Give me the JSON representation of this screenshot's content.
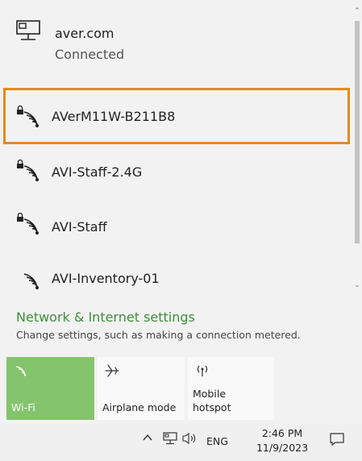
{
  "networks": {
    "connected": {
      "name": "aver.com",
      "status": "Connected"
    },
    "items": [
      {
        "name": "AVerM11W-B211B8",
        "secured": true
      },
      {
        "name": "AVI-Staff-2.4G",
        "secured": true
      },
      {
        "name": "AVI-Staff",
        "secured": true
      },
      {
        "name": "AVI-Inventory-01",
        "secured": false
      }
    ]
  },
  "settings": {
    "title": "Network & Internet settings",
    "description": "Change settings, such as making a connection metered."
  },
  "quick_actions": {
    "wifi": {
      "label": "Wi-Fi",
      "active": true
    },
    "airplane": {
      "label": "Airplane mode"
    },
    "hotspot": {
      "label_line1": "Mobile",
      "label_line2": "hotspot"
    }
  },
  "taskbar": {
    "language": "ENG",
    "time": "2:46 PM",
    "date": "11/9/2023"
  },
  "colors": {
    "accent": "#84c46d",
    "link": "#3f8e3d",
    "selection_border": "#e38a1f"
  }
}
